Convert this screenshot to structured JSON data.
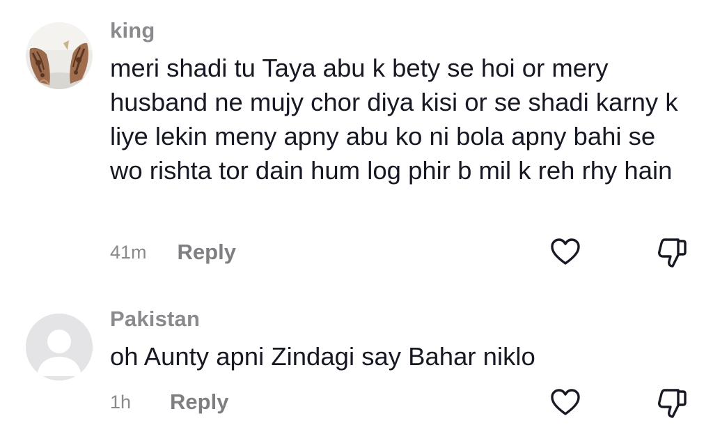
{
  "comments": [
    {
      "username": "king",
      "text": "meri shadi tu Taya abu k bety se hoi or mery husband ne mujy chor diya kisi or se shadi karny k liye lekin meny apny abu ko ni bola apny bahi se wo rishta tor dain hum log phir b mil k reh rhy hain",
      "timestamp": "41m",
      "reply_label": "Reply",
      "avatar_icon": "henna-hands-photo"
    },
    {
      "username": "Pakistan",
      "text": "oh Aunty apni Zindagi say Bahar niklo",
      "timestamp": "1h",
      "reply_label": "Reply",
      "avatar_icon": "default-user-icon"
    }
  ],
  "icons": {
    "like": "heart-outline-icon",
    "dislike": "thumbs-down-outline-icon"
  },
  "colors": {
    "text": "#161823",
    "secondary_text": "#8a8a8e",
    "icon_stroke": "#161823",
    "default_avatar_bg": "#e4e4e6"
  }
}
